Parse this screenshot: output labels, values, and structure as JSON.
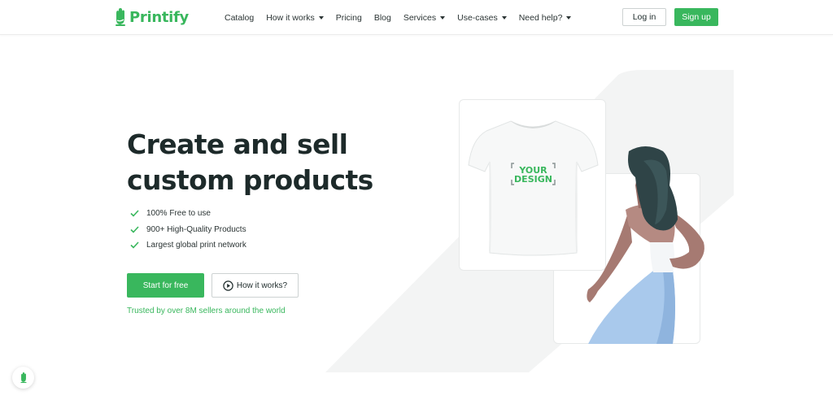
{
  "brand": {
    "name": "Printify",
    "accent_color": "#39b75d",
    "text_color": "#1d2a2a"
  },
  "nav": {
    "items": [
      {
        "label": "Catalog",
        "has_dropdown": false
      },
      {
        "label": "How it works",
        "has_dropdown": true
      },
      {
        "label": "Pricing",
        "has_dropdown": false
      },
      {
        "label": "Blog",
        "has_dropdown": false
      },
      {
        "label": "Services",
        "has_dropdown": true
      },
      {
        "label": "Use-cases",
        "has_dropdown": true
      },
      {
        "label": "Need help?",
        "has_dropdown": true
      }
    ],
    "login_label": "Log in",
    "signup_label": "Sign up"
  },
  "hero": {
    "title_line1": "Create and sell",
    "title_line2": "custom products",
    "features": [
      "100% Free to use",
      "900+ High-Quality Products",
      "Largest global print network"
    ],
    "primary_button": "Start for free",
    "secondary_button": "How it works?",
    "trusted_text": "Trusted by over 8M sellers around the world"
  },
  "illustration": {
    "tshirt_print_line1": "YOUR",
    "tshirt_print_line2": "DESIGN"
  },
  "icons": {
    "logo": "printify-hand-logo-icon",
    "check": "check-icon",
    "play": "play-circle-icon",
    "dropdown": "chevron-down-icon",
    "support": "printify-hand-chat-icon"
  }
}
